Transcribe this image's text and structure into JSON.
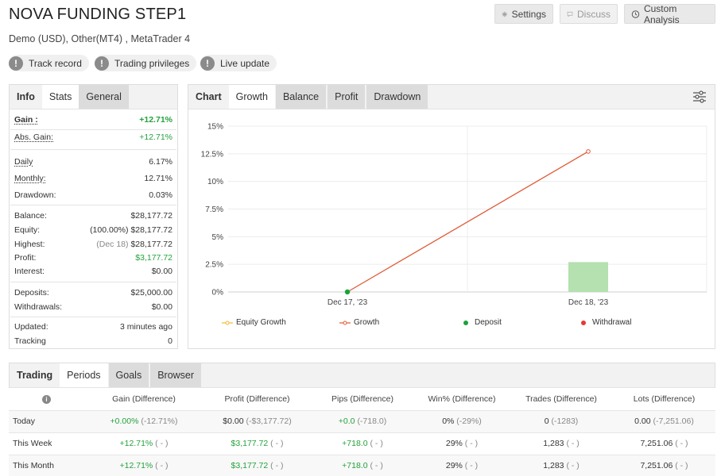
{
  "header": {
    "title": "NOVA FUNDING STEP1",
    "subtitle": "Demo (USD), Other(MT4) , MetaTrader 4",
    "buttons": {
      "settings": "Settings",
      "discuss": "Discuss",
      "custom_analysis": "Custom Analysis"
    },
    "badges": [
      "Track record",
      "Trading privileges",
      "Live update"
    ]
  },
  "info_panel": {
    "tabs": [
      "Info",
      "Stats",
      "General"
    ],
    "rows": {
      "gain": {
        "label": "Gain :",
        "value": "+12.71%"
      },
      "abs_gain": {
        "label": "Abs. Gain:",
        "value": "+12.71%"
      },
      "daily": {
        "label": "Daily",
        "value": "6.17%"
      },
      "monthly": {
        "label": "Monthly:",
        "value": "12.71%"
      },
      "drawdown": {
        "label": "Drawdown:",
        "value": "0.03%"
      },
      "balance": {
        "label": "Balance:",
        "value": "$28,177.72"
      },
      "equity": {
        "label": "Equity:",
        "note": "(100.00%)",
        "value": "$28,177.72"
      },
      "highest": {
        "label": "Highest:",
        "note": "(Dec 18)",
        "value": "$28,177.72"
      },
      "profit": {
        "label": "Profit:",
        "value": "$3,177.72"
      },
      "interest": {
        "label": "Interest:",
        "value": "$0.00"
      },
      "deposits": {
        "label": "Deposits:",
        "value": "$25,000.00"
      },
      "withdrawals": {
        "label": "Withdrawals:",
        "value": "$0.00"
      },
      "updated": {
        "label": "Updated:",
        "value": "3 minutes ago"
      },
      "tracking": {
        "label": "Tracking",
        "value": "0"
      }
    }
  },
  "chart_panel": {
    "tabs": [
      "Chart",
      "Growth",
      "Balance",
      "Profit",
      "Drawdown"
    ]
  },
  "chart_data": {
    "type": "line",
    "categories": [
      "Dec 17, '23",
      "Dec 18, '23"
    ],
    "y_ticks": [
      "15%",
      "12.5%",
      "10%",
      "7.5%",
      "5%",
      "2.5%",
      "0%"
    ],
    "ylim": [
      0,
      15
    ],
    "series": [
      {
        "name": "Equity Growth",
        "color": "#f5b82e",
        "values": []
      },
      {
        "name": "Growth",
        "color": "#e05a35",
        "values": [
          0,
          12.71
        ]
      },
      {
        "name": "Deposit",
        "color": "#1aa33a",
        "values": [
          0
        ]
      },
      {
        "name": "Withdrawal",
        "color": "#e53935",
        "values": []
      }
    ],
    "bars": {
      "category": "Dec 18, '23",
      "value": 2.7,
      "color": "#b5e0b0"
    },
    "grid": true,
    "legend": "bottom"
  },
  "periods_panel": {
    "tabs": [
      "Trading",
      "Periods",
      "Goals",
      "Browser"
    ],
    "columns": [
      "Gain (Difference)",
      "Profit (Difference)",
      "Pips (Difference)",
      "Win% (Difference)",
      "Trades (Difference)",
      "Lots (Difference)"
    ],
    "rows": [
      {
        "label": "Today",
        "cells": [
          [
            "+0.00%",
            "(-12.71%)"
          ],
          [
            "$0.00",
            "(-$3,177.72)"
          ],
          [
            "+0.0",
            "(-718.0)"
          ],
          [
            "0%",
            "(-29%)"
          ],
          [
            "0",
            "(-1283)"
          ],
          [
            "0.00",
            "(-7,251.06)"
          ]
        ]
      },
      {
        "label": "This Week",
        "cells": [
          [
            "+12.71%",
            "( - )"
          ],
          [
            "$3,177.72",
            "( - )"
          ],
          [
            "+718.0",
            "( - )"
          ],
          [
            "29%",
            "( - )"
          ],
          [
            "1,283",
            "( - )"
          ],
          [
            "7,251.06",
            "( - )"
          ]
        ]
      },
      {
        "label": "This Month",
        "cells": [
          [
            "+12.71%",
            "( - )"
          ],
          [
            "$3,177.72",
            "( - )"
          ],
          [
            "+718.0",
            "( - )"
          ],
          [
            "29%",
            "( - )"
          ],
          [
            "1,283",
            "( - )"
          ],
          [
            "7,251.06",
            "( - )"
          ]
        ]
      }
    ]
  }
}
